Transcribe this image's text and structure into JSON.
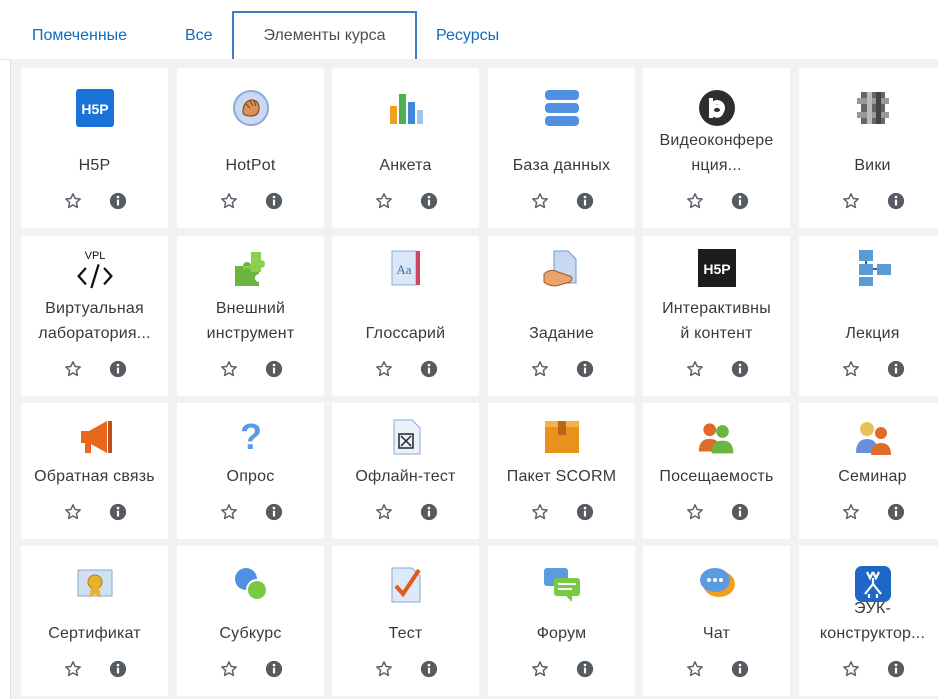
{
  "tabs": [
    {
      "label": "Помеченные",
      "active": false
    },
    {
      "label": "Все",
      "active": false
    },
    {
      "label": "Элементы курса",
      "active": true
    },
    {
      "label": "Ресурсы",
      "active": false
    }
  ],
  "items": [
    {
      "title_lines": [
        "H5P"
      ],
      "icon": "h5p-icon"
    },
    {
      "title_lines": [
        "HotPot"
      ],
      "icon": "hotpot-icon"
    },
    {
      "title_lines": [
        "Анкета"
      ],
      "icon": "survey-icon"
    },
    {
      "title_lines": [
        "База данных"
      ],
      "icon": "database-icon"
    },
    {
      "title_lines": [
        "Видеоконфере",
        "нция..."
      ],
      "icon": "bigbluebutton-icon"
    },
    {
      "title_lines": [
        "Вики"
      ],
      "icon": "wiki-icon"
    },
    {
      "title_lines": [
        "Виртуальная",
        "лаборатория..."
      ],
      "icon": "vpl-icon",
      "icon_text": "VPL"
    },
    {
      "title_lines": [
        "Внешний",
        "инструмент"
      ],
      "icon": "puzzle-icon"
    },
    {
      "title_lines": [
        "Глоссарий"
      ],
      "icon": "glossary-icon",
      "icon_text": "Aa"
    },
    {
      "title_lines": [
        "Задание"
      ],
      "icon": "assignment-icon"
    },
    {
      "title_lines": [
        "Интерактивны",
        "й контент"
      ],
      "icon": "h5p-dark-icon"
    },
    {
      "title_lines": [
        "Лекция"
      ],
      "icon": "lesson-icon"
    },
    {
      "title_lines": [
        "Обратная связь"
      ],
      "icon": "megaphone-icon"
    },
    {
      "title_lines": [
        "Опрос"
      ],
      "icon": "question-icon"
    },
    {
      "title_lines": [
        "Офлайн-тест"
      ],
      "icon": "offline-quiz-icon"
    },
    {
      "title_lines": [
        "Пакет SCORM"
      ],
      "icon": "scorm-icon"
    },
    {
      "title_lines": [
        "Посещаемость"
      ],
      "icon": "attendance-icon"
    },
    {
      "title_lines": [
        "Семинар"
      ],
      "icon": "workshop-icon"
    },
    {
      "title_lines": [
        "Сертификат"
      ],
      "icon": "certificate-icon"
    },
    {
      "title_lines": [
        "Субкурс"
      ],
      "icon": "subcourse-icon"
    },
    {
      "title_lines": [
        "Тест"
      ],
      "icon": "quiz-icon"
    },
    {
      "title_lines": [
        "Форум"
      ],
      "icon": "forum-icon"
    },
    {
      "title_lines": [
        "Чат"
      ],
      "icon": "chat-icon"
    },
    {
      "title_lines": [
        "ЭУК-",
        "конструктор..."
      ],
      "icon": "deer-icon"
    }
  ],
  "colors": {
    "link": "#0f6cbf",
    "panel_bg": "#f2f2f2",
    "action_icon": "#6a737b",
    "active_tab_border": "#3d7fc4"
  }
}
